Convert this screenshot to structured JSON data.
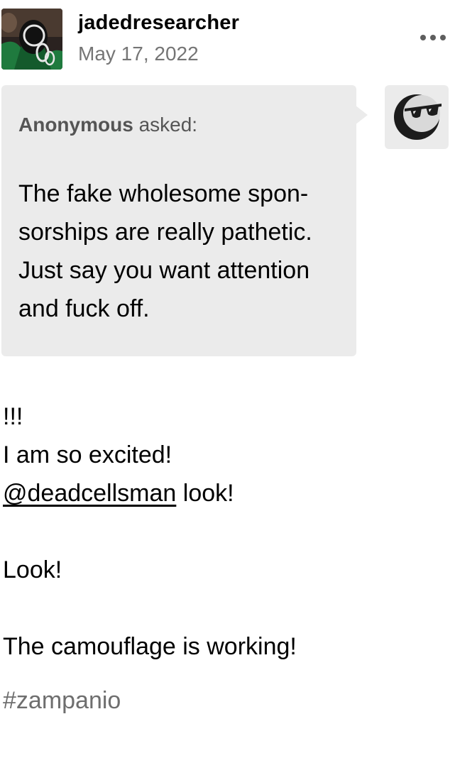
{
  "post": {
    "username": "jadedresearcher",
    "date": "May 17, 2022",
    "more_icon": "more-horizontal-icon"
  },
  "ask": {
    "asker_name": "Anonymous",
    "asker_suffix": "asked:",
    "question_lines": [
      "The fake wholesome spon-",
      "sorships are really pathetic.",
      "Just say you want attention",
      "and fuck off."
    ],
    "anon_avatar_icon": "sunglasses-moon-icon"
  },
  "answer": {
    "line1": "!!!",
    "line2": "I am so excited!",
    "mention": "@deadcellsman",
    "mention_suffix": " look!",
    "line4": "Look!",
    "line5": "The camouflage is working!"
  },
  "tags": [
    "#zampanio"
  ],
  "colors": {
    "bubble": "#ebebeb",
    "muted": "#757575",
    "avatar_green": "#1f7a3e"
  }
}
